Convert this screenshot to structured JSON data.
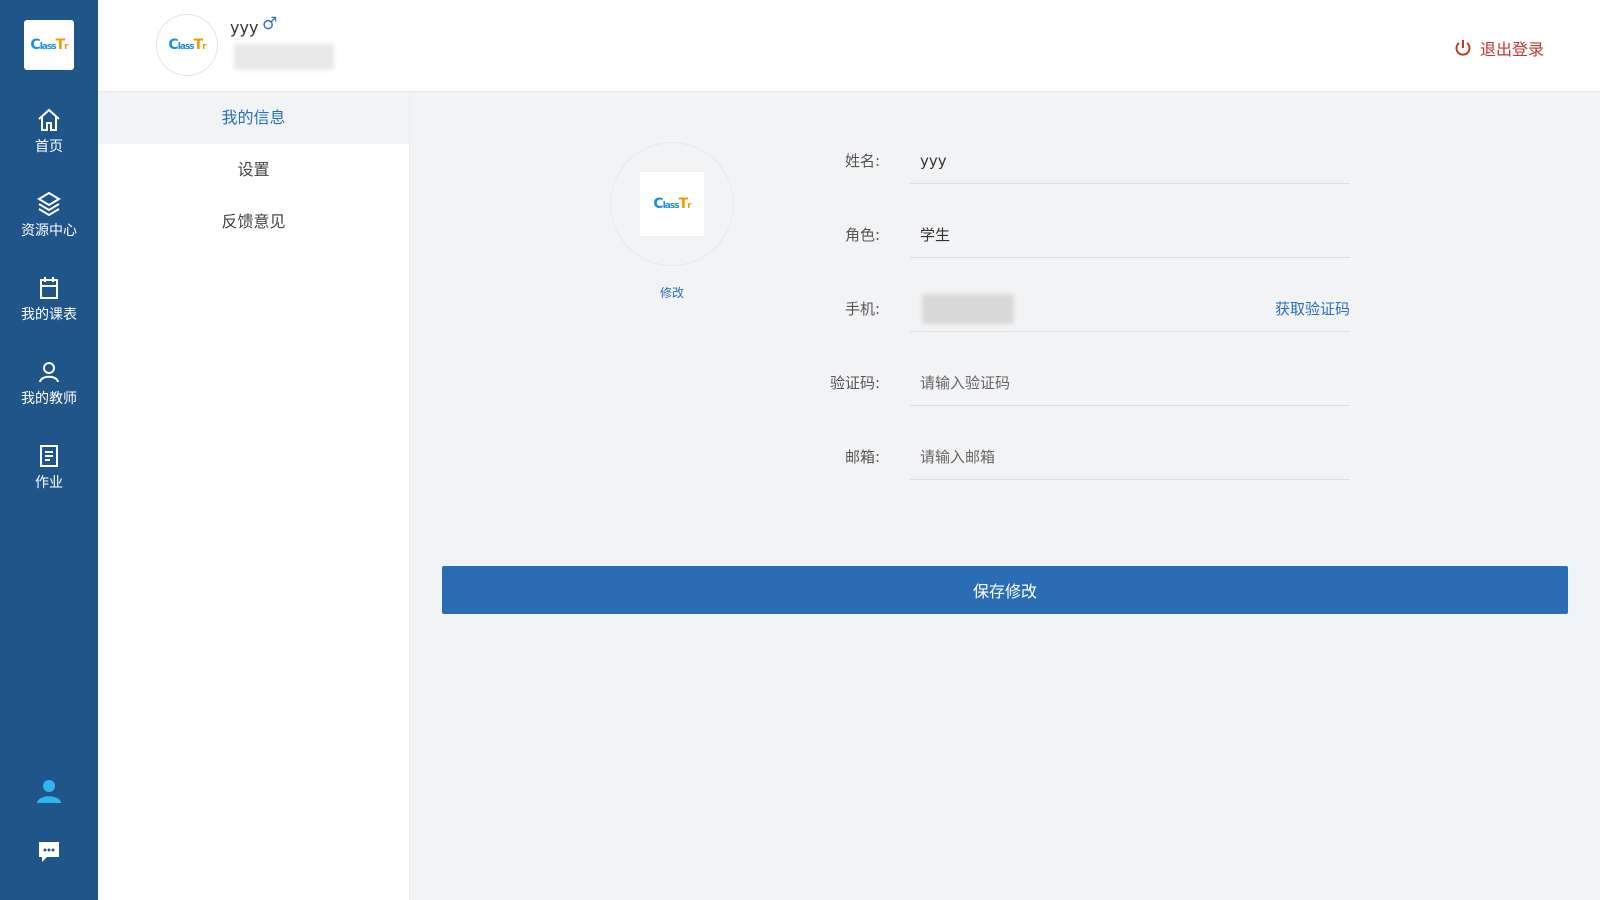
{
  "brand": {
    "logo_text_c": "C",
    "logo_text_rest": "lass",
    "logo_text_t": "T",
    "logo_text_end": "r"
  },
  "colors": {
    "rail": "#20558a",
    "accent": "#2a6fbf",
    "logout": "#c0392b",
    "button": "#2a6db5"
  },
  "rail": {
    "items": [
      {
        "label": "首页",
        "icon": "home-icon"
      },
      {
        "label": "资源中心",
        "icon": "resource-icon"
      },
      {
        "label": "我的课表",
        "icon": "calendar-icon"
      },
      {
        "label": "我的教师",
        "icon": "user-icon"
      },
      {
        "label": "作业",
        "icon": "homework-icon"
      }
    ],
    "bottom": [
      {
        "icon": "profile-icon"
      },
      {
        "icon": "chat-icon"
      }
    ]
  },
  "header": {
    "username": "yyy",
    "gender_symbol": "♂",
    "logout_label": "退出登录"
  },
  "submenu": {
    "items": [
      {
        "label": "我的信息"
      },
      {
        "label": "设置"
      },
      {
        "label": "反馈意见"
      }
    ]
  },
  "profile": {
    "edit_label": "修改",
    "fields": {
      "name": {
        "label": "姓名:",
        "value": "yyy"
      },
      "role": {
        "label": "角色:",
        "value": "学生"
      },
      "phone": {
        "label": "手机:",
        "action": "获取验证码"
      },
      "code": {
        "label": "验证码:",
        "placeholder": "请输入验证码"
      },
      "email": {
        "label": "邮箱:",
        "placeholder": "请输入邮箱"
      }
    },
    "save_label": "保存修改"
  }
}
